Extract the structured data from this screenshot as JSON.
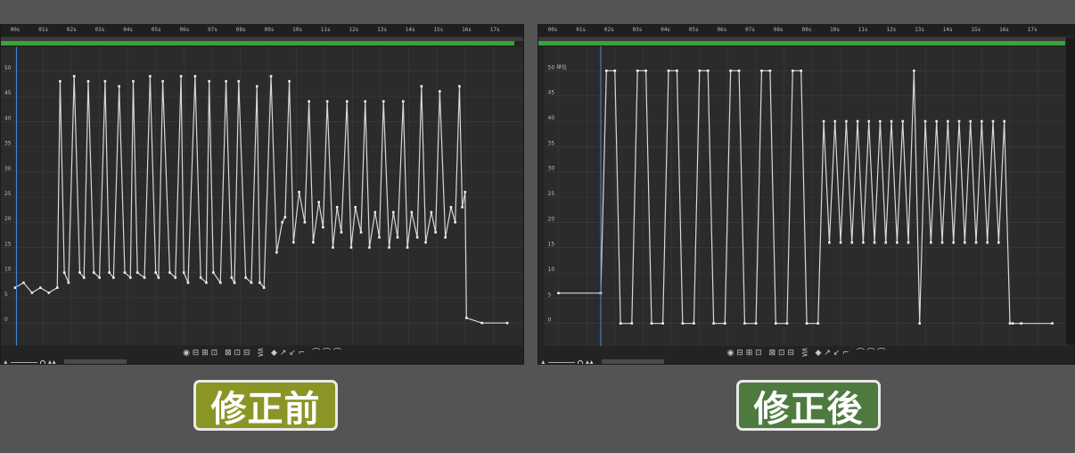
{
  "ruler_ticks": [
    "00s",
    "01s",
    "02s",
    "03s",
    "04s",
    "05s",
    "06s",
    "07s",
    "08s",
    "09s",
    "10s",
    "11s",
    "12s",
    "13s",
    "14s",
    "15s",
    "16s",
    "17s"
  ],
  "y_axis": {
    "ticks": [
      0,
      5,
      10,
      15,
      20,
      25,
      30,
      35,
      40,
      45,
      50
    ],
    "unit": "50 単位"
  },
  "toolbar": [
    "◉ ⊟ ⊞ ⊡",
    "⊠ ⊡ ⊟",
    "⋚",
    "◆ ↗ ↙ ⌐",
    "⌒ ⌒ ⌒"
  ],
  "left_panel": {
    "label": "修正前",
    "label_color": "#8a9526"
  },
  "right_panel": {
    "label": "修正後",
    "label_color": "#4e7a40"
  },
  "colors": {
    "background": "#545454",
    "panel": "#232323",
    "grid": "#3c3c3c",
    "curve": "#d8d8d8",
    "work_area": "#3aa33a",
    "playhead": "#3d8fe0"
  },
  "chart_data": [
    {
      "type": "line",
      "x_unit": "s",
      "xlim": [
        0,
        17.5
      ],
      "ylim": [
        -2,
        52
      ],
      "series": [
        {
          "x": [
            0.0,
            0.3,
            0.6,
            0.9,
            1.2,
            1.5,
            1.6,
            1.75,
            1.9,
            2.1,
            2.3,
            2.45,
            2.6,
            2.8,
            3.0,
            3.2,
            3.35,
            3.5,
            3.7,
            3.9,
            4.1,
            4.2,
            4.35,
            4.6,
            4.8,
            5.0,
            5.1,
            5.25,
            5.5,
            5.7,
            5.9,
            6.0,
            6.15,
            6.4,
            6.6,
            6.8,
            6.9,
            7.05,
            7.3,
            7.5,
            7.7,
            7.8,
            7.95,
            8.2,
            8.4,
            8.6,
            8.7,
            8.85,
            9.1,
            9.3,
            9.5,
            9.6,
            9.75,
            9.9,
            10.1,
            10.3,
            10.45,
            10.6,
            10.8,
            10.95,
            11.1,
            11.3,
            11.45,
            11.6,
            11.8,
            11.95,
            12.1,
            12.3,
            12.45,
            12.6,
            12.8,
            12.95,
            13.1,
            13.3,
            13.45,
            13.6,
            13.8,
            13.95,
            14.1,
            14.3,
            14.45,
            14.6,
            14.8,
            14.95,
            15.1,
            15.3,
            15.5,
            15.65,
            15.8,
            15.9,
            16.0,
            16.05,
            16.6,
            17.5
          ],
          "y": [
            7,
            8,
            6,
            7,
            6,
            7,
            48,
            10,
            8,
            49,
            10,
            9,
            48,
            10,
            9,
            48,
            10,
            9,
            47,
            10,
            9,
            48,
            10,
            9,
            49,
            10,
            9,
            48,
            10,
            9,
            49,
            10,
            8,
            49,
            9,
            8,
            48,
            10,
            8,
            48,
            9,
            8,
            48,
            9,
            8,
            47,
            8,
            7,
            49,
            14,
            20,
            21,
            48,
            16,
            26,
            20,
            44,
            16,
            24,
            19,
            44,
            15,
            23,
            18,
            44,
            15,
            23,
            18,
            44,
            15,
            22,
            17,
            44,
            15,
            22,
            17,
            44,
            15,
            22,
            17,
            47,
            16,
            22,
            18,
            46,
            17,
            23,
            20,
            47,
            23,
            26,
            1,
            0,
            0
          ]
        }
      ]
    },
    {
      "type": "line",
      "x_unit": "s",
      "xlim": [
        0,
        17.5
      ],
      "ylim": [
        -2,
        52
      ],
      "series": [
        {
          "x": [
            0.0,
            1.5,
            1.7,
            2.0,
            2.2,
            2.6,
            2.8,
            3.1,
            3.3,
            3.7,
            3.9,
            4.2,
            4.4,
            4.8,
            5.0,
            5.3,
            5.5,
            5.9,
            6.1,
            6.4,
            6.6,
            7.0,
            7.2,
            7.5,
            7.7,
            8.1,
            8.3,
            8.6,
            8.8,
            9.2,
            9.4,
            9.6,
            9.8,
            10.0,
            10.2,
            10.4,
            10.6,
            10.8,
            11.0,
            11.2,
            11.4,
            11.6,
            11.8,
            12.0,
            12.2,
            12.4,
            12.6,
            12.8,
            13.0,
            13.2,
            13.4,
            13.6,
            13.8,
            14.0,
            14.2,
            14.4,
            14.6,
            14.8,
            15.0,
            15.2,
            15.4,
            15.6,
            15.8,
            16.0,
            16.1,
            16.4,
            17.5
          ],
          "y": [
            6,
            6,
            50,
            50,
            0,
            0,
            50,
            50,
            0,
            0,
            50,
            50,
            0,
            0,
            50,
            50,
            0,
            0,
            50,
            50,
            0,
            0,
            50,
            50,
            0,
            0,
            50,
            50,
            0,
            0,
            40,
            16,
            40,
            16,
            40,
            16,
            40,
            16,
            40,
            16,
            40,
            16,
            40,
            16,
            40,
            16,
            50,
            0,
            40,
            16,
            40,
            16,
            40,
            16,
            40,
            16,
            40,
            16,
            40,
            16,
            40,
            16,
            40,
            0,
            0,
            0,
            0
          ]
        }
      ]
    }
  ]
}
